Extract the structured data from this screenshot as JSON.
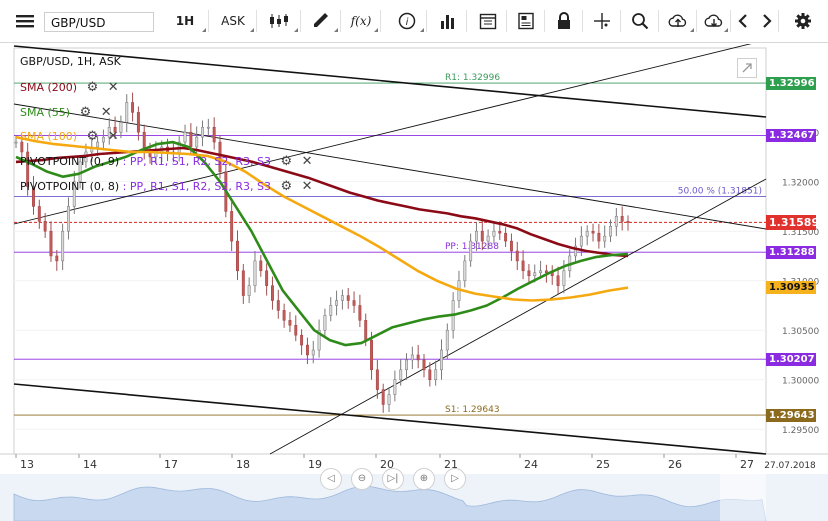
{
  "toolbar": {
    "symbol": "GBP/USD",
    "timeframe": "1H",
    "price_side": "ASK",
    "fx_label": "f(x)"
  },
  "legend": {
    "title": "GBP/USD, 1H, ASK",
    "sma200": "SMA (200)",
    "sma55": "SMA (55)",
    "sma100": "SMA (100)",
    "pivot1_name": "PIVOTPOINT (0, 9)",
    "pivot1_items": "PP, R1, S1, R2, S2, R3, S3",
    "pivot2_name": "PIVOTPOINT (0, 8)",
    "pivot2_items": "PP, R1, S1, R2, S2, R3, S3"
  },
  "colors": {
    "sma200": "#8b0a16",
    "sma55": "#2e8b1a",
    "sma100": "#f5a90f",
    "pivot_text": "#8a2be2",
    "r1": "#3a9a5c",
    "s1": "#8b6a1e",
    "fib": "#6a5acd",
    "current": "#d62020"
  },
  "chart_data": {
    "type": "line",
    "y_range": [
      1.2925,
      1.3335
    ],
    "y_ticks": [
      "1.32500",
      "1.32000",
      "1.31500",
      "1.31000",
      "1.30500",
      "1.30000",
      "1.29500"
    ],
    "x_labels": [
      "13",
      "14",
      "17",
      "18",
      "19",
      "20",
      "21",
      "24",
      "25",
      "26",
      "27",
      "27.07.2018"
    ],
    "levels": [
      {
        "name": "R1",
        "label": "R1: 1.32996",
        "value": 1.32996,
        "box": "1.32996"
      },
      {
        "name": "upper",
        "value": 1.32467,
        "box": "1.32467"
      },
      {
        "name": "fib50",
        "label": "50.00 % (1.31851)",
        "value": 1.31851
      },
      {
        "name": "current",
        "value": 1.31589,
        "box": "1.31589"
      },
      {
        "name": "PP",
        "label": "PP: 1.31288",
        "value": 1.31288,
        "box": "1.31288"
      },
      {
        "name": "sma100_last",
        "value": 1.30935,
        "box": "1.30935"
      },
      {
        "name": "lower",
        "value": 1.30207,
        "box": "1.30207"
      },
      {
        "name": "S1",
        "label": "S1: 1.29643",
        "value": 1.29643,
        "box": "1.29643"
      }
    ],
    "price_close": [
      1.324,
      1.323,
      1.3195,
      1.3175,
      1.316,
      1.315,
      1.3125,
      1.312,
      1.315,
      1.3175,
      1.32,
      1.322,
      1.323,
      1.3235,
      1.324,
      1.3245,
      1.3255,
      1.325,
      1.326,
      1.328,
      1.327,
      1.325,
      1.323,
      1.3225,
      1.323,
      1.3235,
      1.323,
      1.3228,
      1.324,
      1.325,
      1.3235,
      1.3245,
      1.3255,
      1.3255,
      1.324,
      1.321,
      1.317,
      1.314,
      1.311,
      1.3085,
      1.3095,
      1.312,
      1.311,
      1.3095,
      1.308,
      1.307,
      1.306,
      1.3055,
      1.3045,
      1.3035,
      1.3025,
      1.303,
      1.305,
      1.3065,
      1.3075,
      1.308,
      1.3085,
      1.308,
      1.3075,
      1.306,
      1.304,
      1.301,
      1.299,
      1.2975,
      1.2985,
      1.3,
      1.301,
      1.302,
      1.3025,
      1.302,
      1.301,
      1.3,
      1.301,
      1.303,
      1.305,
      1.308,
      1.31,
      1.312,
      1.314,
      1.315,
      1.314,
      1.3145,
      1.315,
      1.3148,
      1.314,
      1.313,
      1.312,
      1.311,
      1.3105,
      1.3108,
      1.311,
      1.3108,
      1.3105,
      1.3095,
      1.311,
      1.3125,
      1.3135,
      1.3145,
      1.315,
      1.3148,
      1.314,
      1.3145,
      1.3155,
      1.3165,
      1.316,
      1.3159
    ],
    "series": [
      {
        "name": "SMA (200)",
        "values": [
          1.322,
          1.3221,
          1.3222,
          1.3224,
          1.3225,
          1.3226,
          1.3228,
          1.3229,
          1.323,
          1.3231,
          1.3232,
          1.3233,
          1.3234,
          1.3232,
          1.3229,
          1.3226,
          1.3223,
          1.322,
          1.3216,
          1.3212,
          1.3208,
          1.3204,
          1.3199,
          1.3194,
          1.3189,
          1.3185,
          1.3181,
          1.3178,
          1.3175,
          1.3172,
          1.317,
          1.3168,
          1.3165,
          1.3163,
          1.316,
          1.3157,
          1.3153,
          1.3147,
          1.3142,
          1.3137,
          1.3133,
          1.313,
          1.3128,
          1.3126,
          1.3125
        ]
      },
      {
        "name": "SMA (55)",
        "values": [
          1.3225,
          1.3218,
          1.321,
          1.3205,
          1.3208,
          1.3215,
          1.322,
          1.3225,
          1.3232,
          1.3238,
          1.324,
          1.3235,
          1.322,
          1.32,
          1.3175,
          1.315,
          1.312,
          1.309,
          1.307,
          1.305,
          1.304,
          1.3035,
          1.3037,
          1.3045,
          1.3053,
          1.3057,
          1.3061,
          1.3064,
          1.3066,
          1.307,
          1.3075,
          1.3083,
          1.3092,
          1.31,
          1.3108,
          1.3115,
          1.312,
          1.3124,
          1.3126,
          1.3127
        ]
      },
      {
        "name": "SMA (100)",
        "values": [
          1.3245,
          1.3241,
          1.3238,
          1.3236,
          1.3234,
          1.3232,
          1.323,
          1.323,
          1.3229,
          1.3228,
          1.3226,
          1.322,
          1.321,
          1.3197,
          1.3185,
          1.3175,
          1.3165,
          1.3155,
          1.3145,
          1.3134,
          1.3122,
          1.311,
          1.31,
          1.3092,
          1.3087,
          1.3084,
          1.3081,
          1.308,
          1.3081,
          1.3083,
          1.3086,
          1.309,
          1.3093
        ]
      }
    ]
  },
  "nav": [
    "◁",
    "⊖",
    "▷|",
    "⊕",
    "▷"
  ]
}
